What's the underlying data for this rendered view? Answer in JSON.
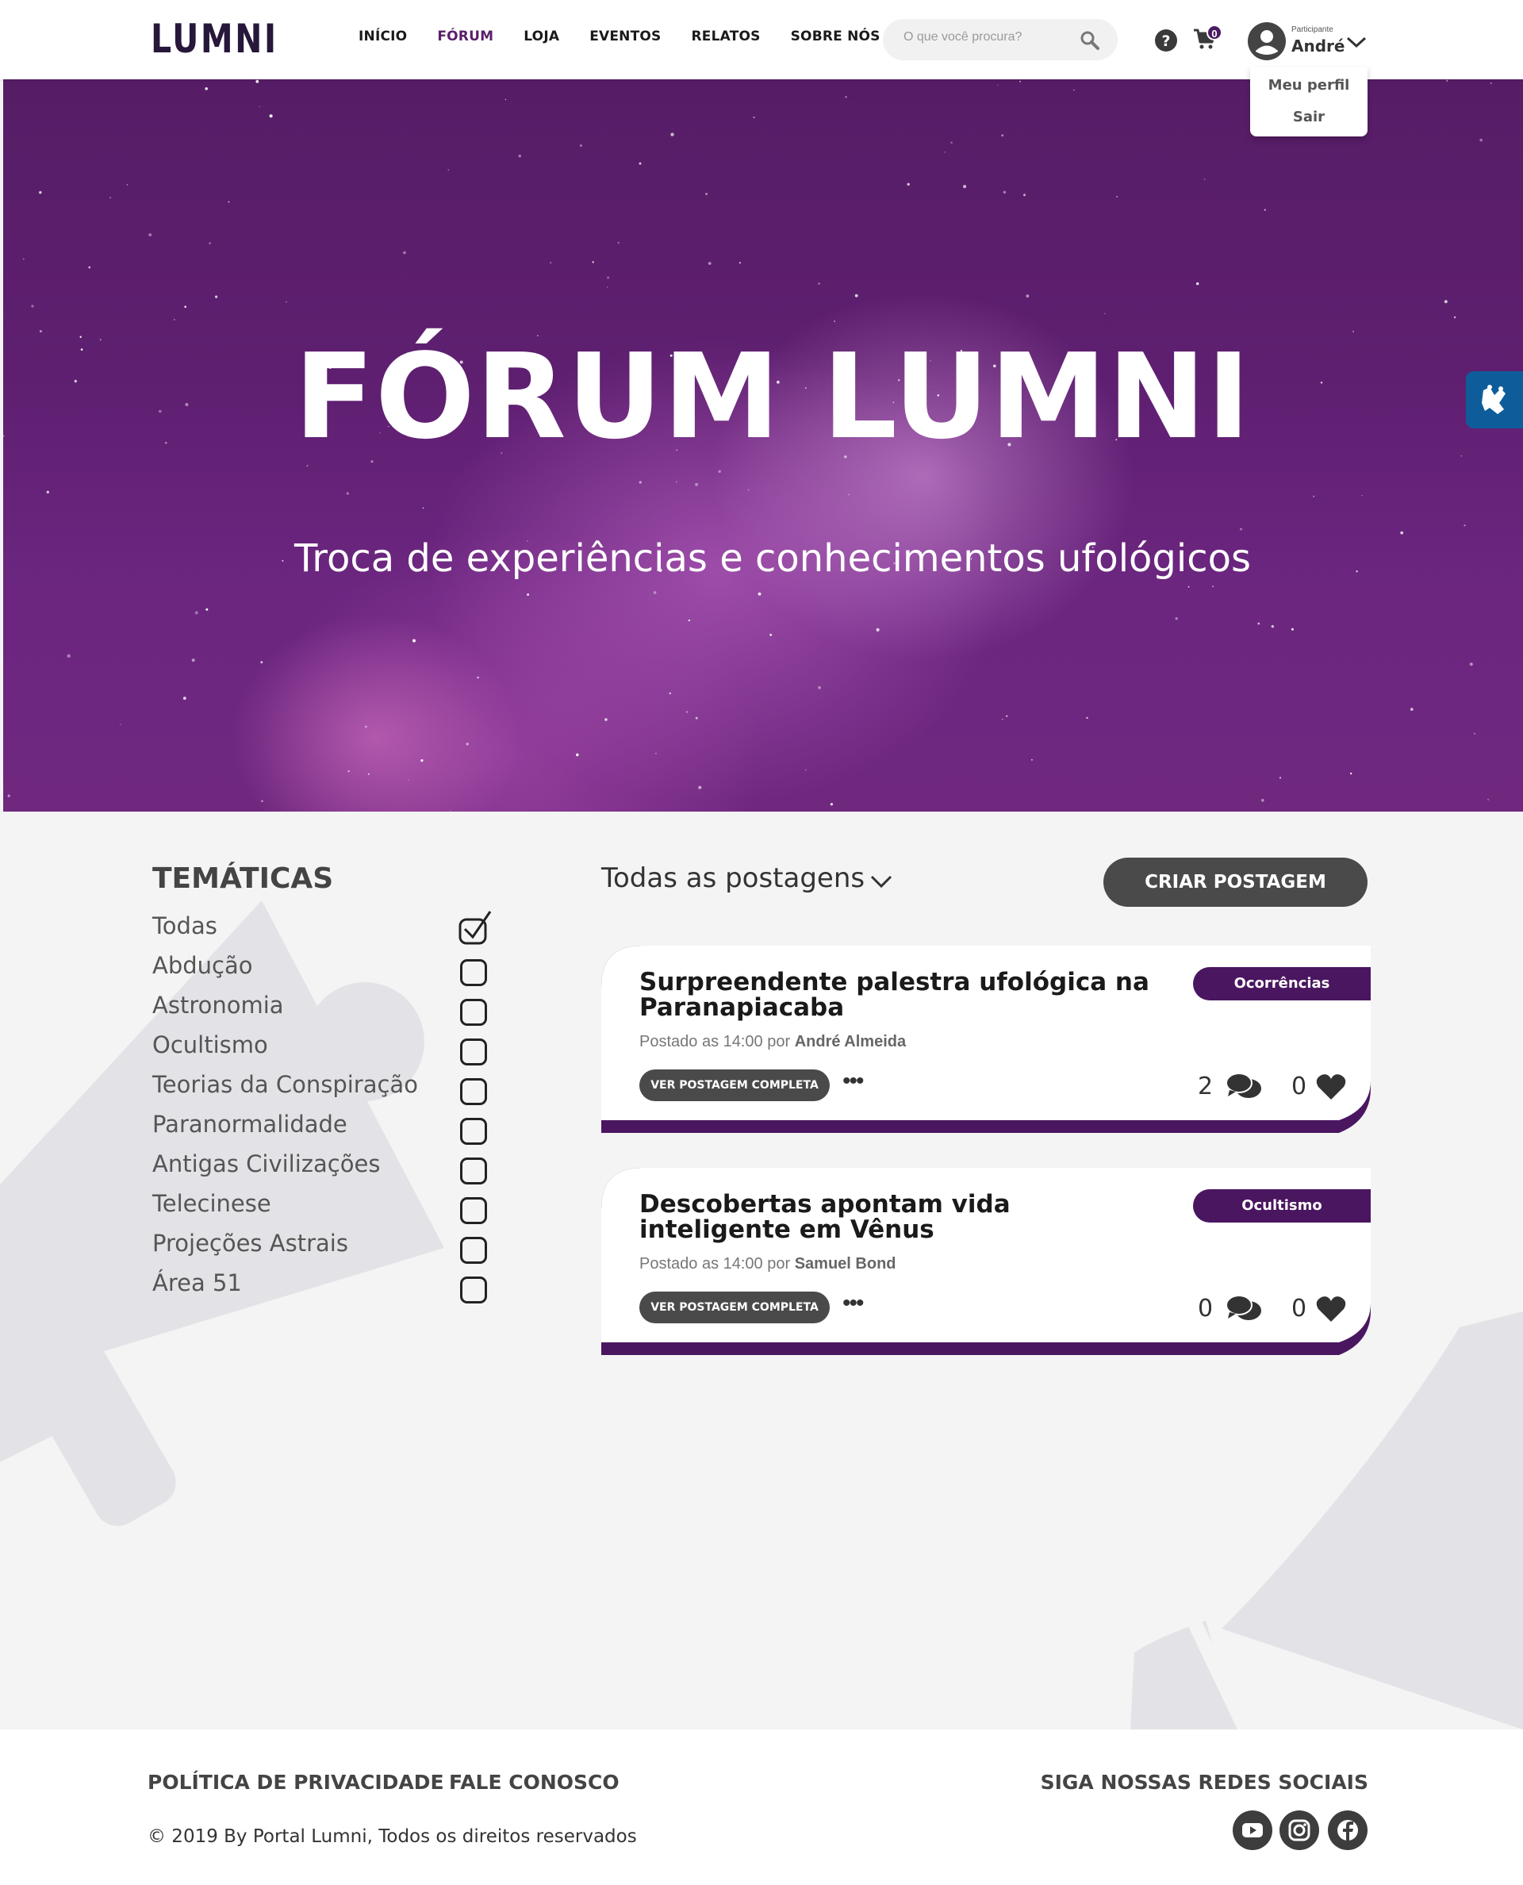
{
  "brand": {
    "name": "LUMNI"
  },
  "nav": {
    "items": [
      {
        "label": "INÍCIO",
        "active": false
      },
      {
        "label": "FÓRUM",
        "active": true
      },
      {
        "label": "LOJA",
        "active": false
      },
      {
        "label": "EVENTOS",
        "active": false
      },
      {
        "label": "RELATOS",
        "active": false
      },
      {
        "label": "SOBRE NÓS",
        "active": false
      }
    ]
  },
  "search": {
    "placeholder": "O que você procura?",
    "value": "",
    "icon": "search-icon"
  },
  "header": {
    "help_icon": "question-circle-icon",
    "cart_icon": "shopping-cart-icon",
    "cart_count": "0",
    "user": {
      "role": "Participante",
      "name": "André",
      "avatar_icon": "user-circle-icon"
    },
    "user_menu": [
      "Meu perfil",
      "Sair"
    ]
  },
  "hero": {
    "title": "FÓRUM LUMNI",
    "subtitle": "Troca de experiências e conhecimentos ufológicos"
  },
  "accessibility": {
    "icon": "sign-language-hands-icon"
  },
  "topics": {
    "title": "TEMÁTICAS",
    "items": [
      {
        "label": "Todas",
        "checked": true
      },
      {
        "label": "Abdução",
        "checked": false
      },
      {
        "label": "Astronomia",
        "checked": false
      },
      {
        "label": "Ocultismo",
        "checked": false
      },
      {
        "label": "Teorias da Conspiração",
        "checked": false
      },
      {
        "label": "Paranormalidade",
        "checked": false
      },
      {
        "label": "Antigas Civilizações",
        "checked": false
      },
      {
        "label": "Telecinese",
        "checked": false
      },
      {
        "label": "Projeções Astrais",
        "checked": false
      },
      {
        "label": "Área 51",
        "checked": false
      }
    ]
  },
  "posts": {
    "filter_label": "Todas as postagens",
    "create_label": "CRIAR POSTAGEM",
    "view_label": "VER POSTAGEM COMPLETA",
    "more_label": "•••",
    "items": [
      {
        "title": "Surpreendente palestra ufológica na Paranapiacaba",
        "meta_prefix": "Postado as 14:00 por",
        "author": "André Almeida",
        "tag": "Ocorrências",
        "comments": "2",
        "likes": "0"
      },
      {
        "title": "Descobertas apontam vida inteligente em Vênus",
        "meta_prefix": "Postado as 14:00 por",
        "author": "Samuel Bond",
        "tag": "Ocultismo",
        "comments": "0",
        "likes": "0"
      }
    ]
  },
  "footer": {
    "privacy": "POLÍTICA DE PRIVACIDADE",
    "contact": "FALE CONOSCO",
    "social_title": "SIGA NOSSAS REDES SOCIAIS",
    "copyright": "© 2019 By Portal Lumni, Todos os direitos reservados",
    "social": [
      "youtube-icon",
      "instagram-icon",
      "facebook-icon"
    ]
  },
  "colors": {
    "brand_purple": "#4a1660",
    "nav_active": "#5a1f6b",
    "button_dark": "#4a4a4a",
    "libras_blue": "#0e5d9a"
  }
}
